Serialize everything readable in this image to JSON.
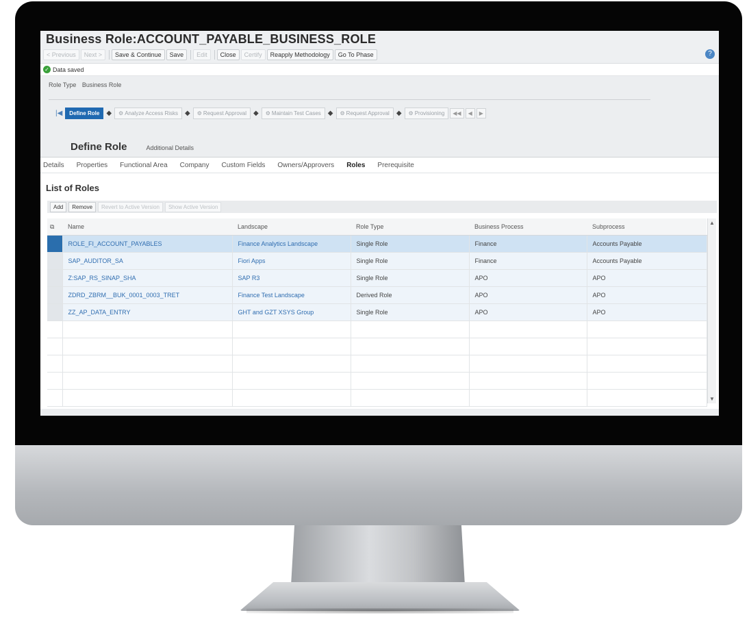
{
  "page_title": "Business Role:ACCOUNT_PAYABLE_BUSINESS_ROLE",
  "toolbar": {
    "buttons": [
      {
        "label": "< Previous",
        "disabled": true
      },
      {
        "label": "Next >",
        "disabled": true
      },
      {
        "label": "Save & Continue",
        "disabled": false
      },
      {
        "label": "Save",
        "disabled": false
      },
      {
        "label": "Edit",
        "disabled": true
      },
      {
        "label": "Close",
        "disabled": false
      },
      {
        "label": "Certify",
        "disabled": true
      },
      {
        "label": "Reapply Methodology",
        "disabled": false
      },
      {
        "label": "Go To Phase",
        "disabled": false
      }
    ]
  },
  "message": "Data saved",
  "role_type": {
    "label": "Role Type",
    "value": "Business Role"
  },
  "roadmap": {
    "steps": [
      {
        "label": "Define Role",
        "active": true
      },
      {
        "label": "Analyze Access Risks",
        "active": false
      },
      {
        "label": "Request Approval",
        "active": false
      },
      {
        "label": "Maintain Test Cases",
        "active": false
      },
      {
        "label": "Request Approval",
        "active": false
      },
      {
        "label": "Provisioning",
        "active": false
      }
    ]
  },
  "header_tabs": {
    "main": "Define Role",
    "secondary": "Additional Details"
  },
  "subtabs": [
    {
      "label": "Details",
      "active": false
    },
    {
      "label": "Properties",
      "active": false
    },
    {
      "label": "Functional Area",
      "active": false
    },
    {
      "label": "Company",
      "active": false
    },
    {
      "label": "Custom Fields",
      "active": false
    },
    {
      "label": "Owners/Approvers",
      "active": false
    },
    {
      "label": "Roles",
      "active": true
    },
    {
      "label": "Prerequisite",
      "active": false
    }
  ],
  "list": {
    "title": "List of Roles",
    "buttons": [
      {
        "label": "Add",
        "disabled": false
      },
      {
        "label": "Remove",
        "disabled": false
      },
      {
        "label": "Revert to Active Version",
        "disabled": true
      },
      {
        "label": "Show Active Version",
        "disabled": true
      }
    ],
    "columns": [
      "Name",
      "Landscape",
      "Role Type",
      "Business Process",
      "Subprocess"
    ],
    "rows": [
      [
        "ROLE_FI_ACCOUNT_PAYABLES",
        "Finance Analytics Landscape",
        "Single Role",
        "Finance",
        "Accounts Payable"
      ],
      [
        "SAP_AUDITOR_SA",
        "Fiori Apps",
        "Single Role",
        "Finance",
        "Accounts Payable"
      ],
      [
        "Z:SAP_RS_SINAP_SHA",
        "SAP R3",
        "Single Role",
        "APO",
        "APO"
      ],
      [
        "ZDRD_ZBRM__BUK_0001_0003_TRET",
        "Finance Test Landscape",
        "Derived Role",
        "APO",
        "APO"
      ],
      [
        "ZZ_AP_DATA_ENTRY",
        "GHT and GZT XSYS Group",
        "Single Role",
        "APO",
        "APO"
      ]
    ],
    "selected_row": 0,
    "empty_rows": 5
  }
}
